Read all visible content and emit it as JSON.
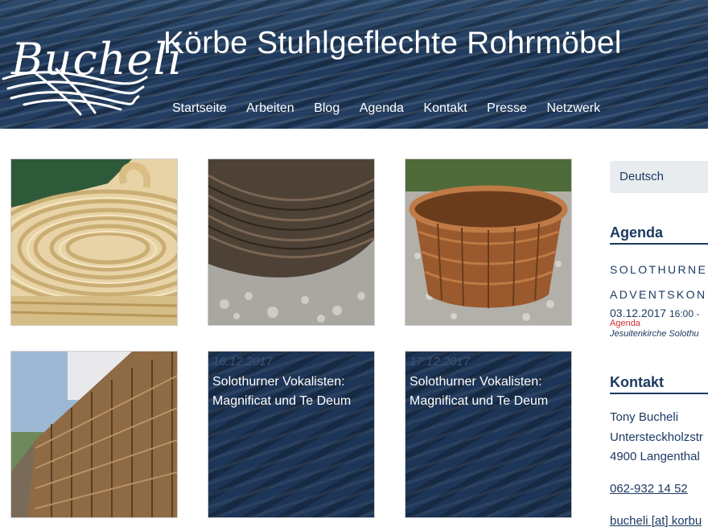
{
  "header": {
    "logo_text": "Bucheli",
    "title": "Körbe Stuhlgeflechte Rohrmöbel"
  },
  "nav": {
    "items": [
      "Startseite",
      "Arbeiten",
      "Blog",
      "Agenda",
      "Kontakt",
      "Presse",
      "Netzwerk"
    ]
  },
  "posts": [
    {
      "date": "16.12.2017",
      "title": "Solothurner Vokalisten: Magnificat und Te Deum"
    },
    {
      "date": "17.12.2017",
      "title": "Solothurner Vokalisten: Magnificat und Te Deum"
    }
  ],
  "sidebar": {
    "language": "Deutsch",
    "agenda": {
      "title": "Agenda",
      "event_line1": "SOLOTHURNE",
      "event_line2": "ADVENTSKON",
      "event_date": "03.12.2017",
      "event_time": "16:00 -",
      "event_category": "Agenda",
      "event_location": "Jesuitenkirche Solothu"
    },
    "contact": {
      "title": "Kontakt",
      "name": "Tony Bucheli",
      "street": "Untersteckholzstr",
      "city": "4900 Langenthal",
      "phone": "062-932 14 52",
      "email": "bucheli [at] korbu"
    }
  },
  "colors": {
    "brand_navy": "#1c3a62",
    "header_bg": "#243f63",
    "agenda_category": "#d03030"
  }
}
